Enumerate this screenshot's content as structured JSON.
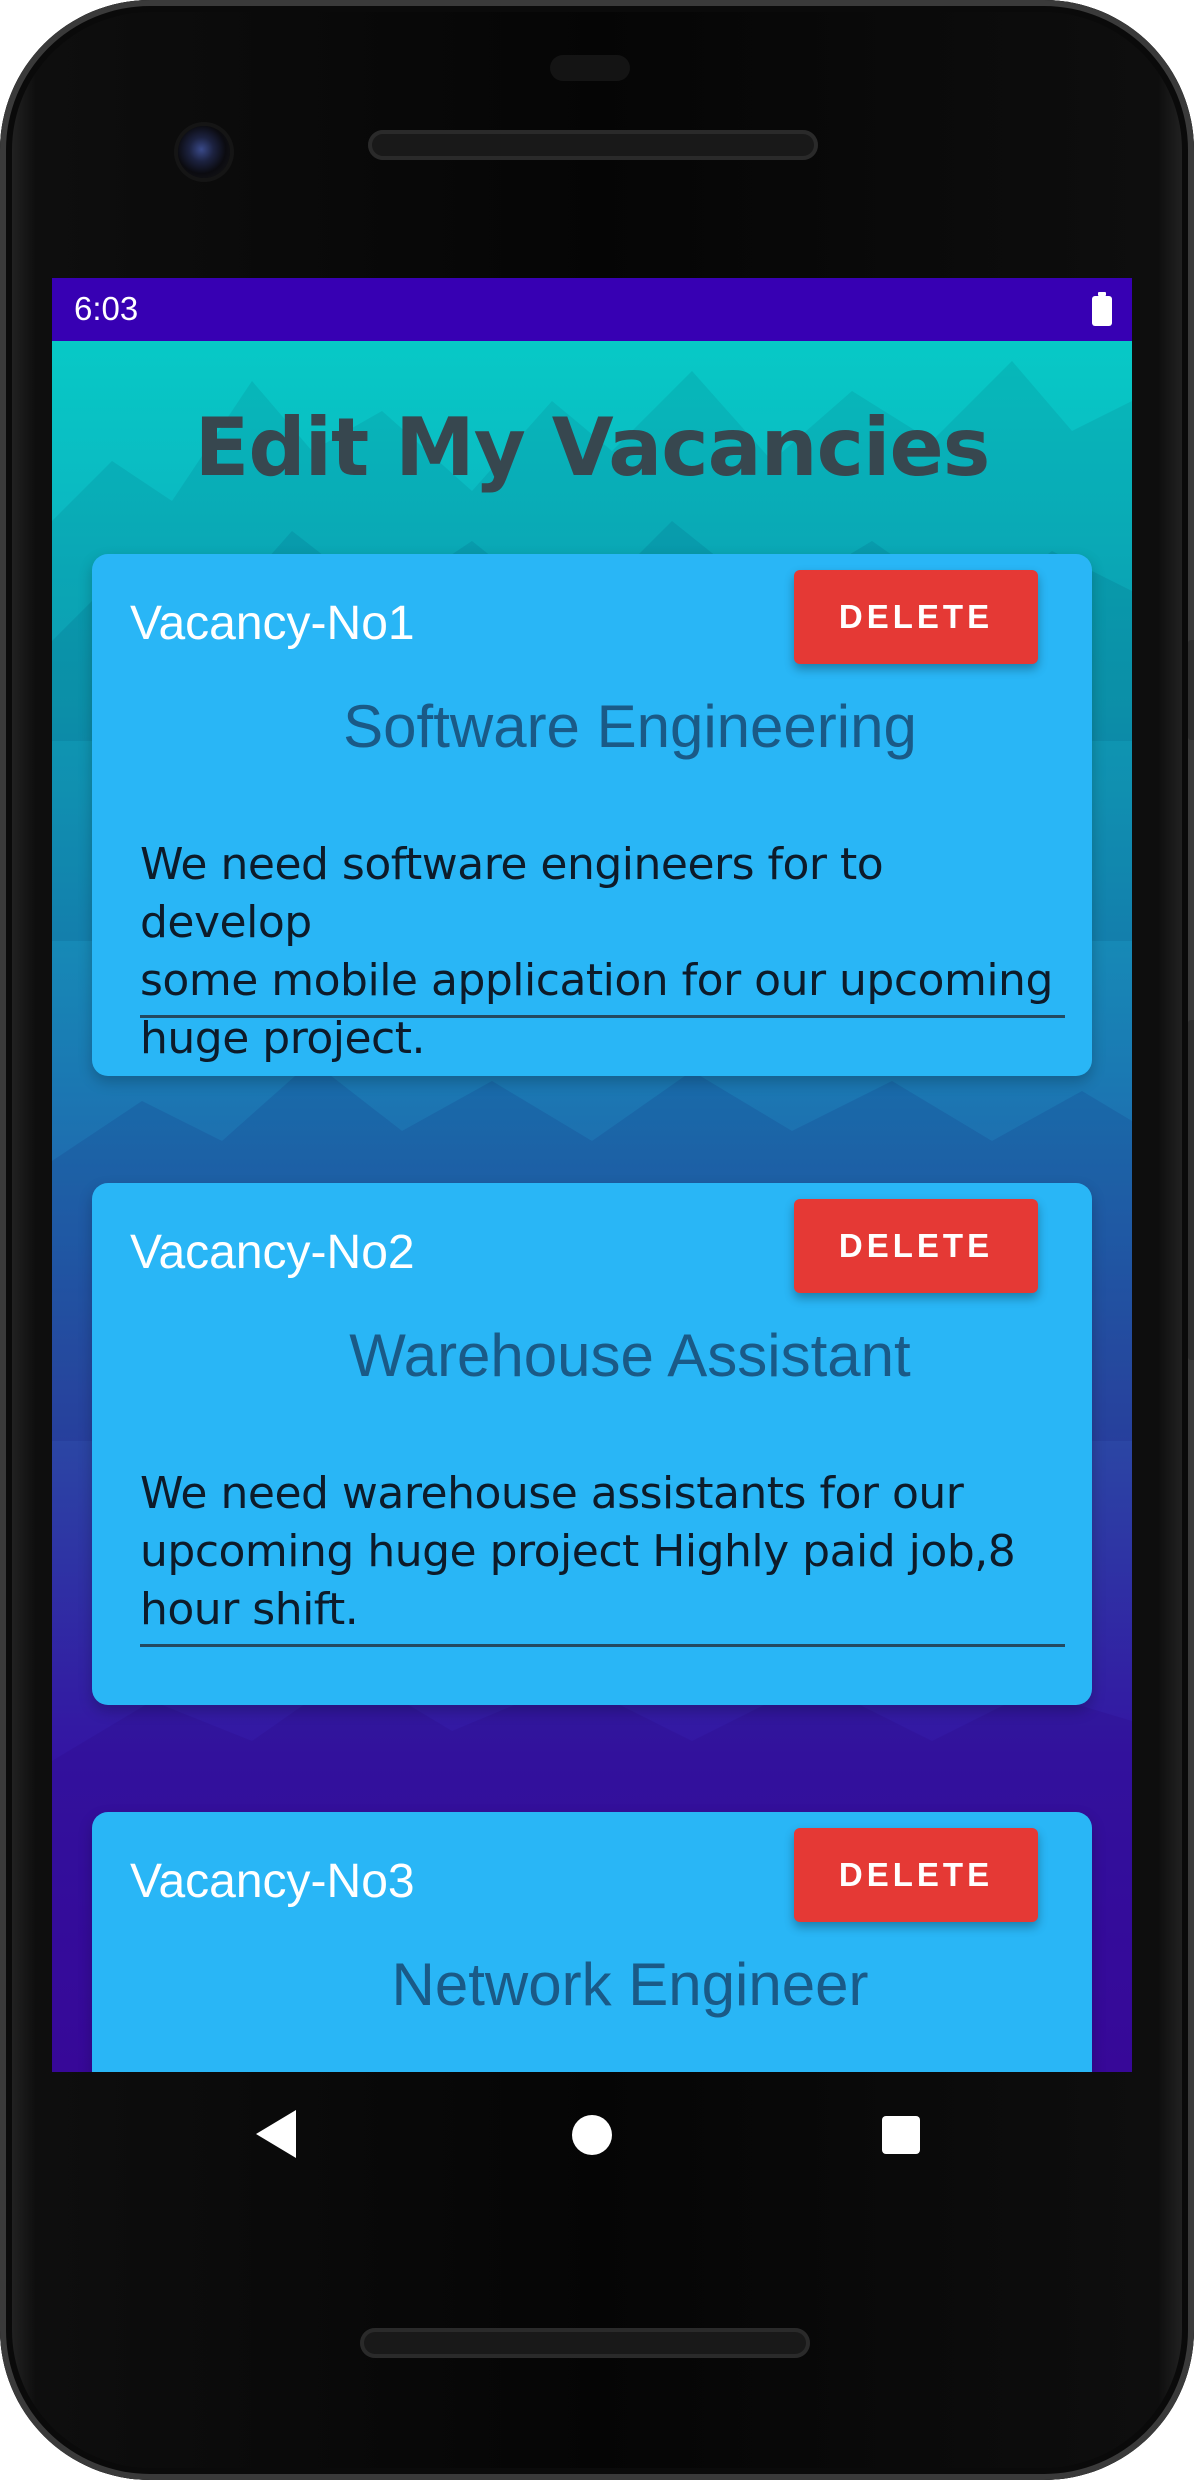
{
  "status_bar": {
    "time": "6:03",
    "icon": "battery-icon"
  },
  "page": {
    "title": "Edit My Vacancies"
  },
  "colors": {
    "status_bar": "#3700b3",
    "card": "#29b6f6",
    "delete_button": "#e53935",
    "title_text": "#37474f"
  },
  "vacancies": [
    {
      "number": "Vacancy-No1",
      "delete_label": "DELETE",
      "title": "Software Engineering",
      "description_lines": [
        "We need software engineers for to develop",
        "some mobile application for our upcoming",
        "huge project."
      ]
    },
    {
      "number": "Vacancy-No2",
      "delete_label": "DELETE",
      "title": "Warehouse Assistant",
      "description_lines": [
        "We need warehouse assistants for our",
        "upcoming huge project Highly paid job,8",
        "hour shift."
      ]
    },
    {
      "number": "Vacancy-No3",
      "delete_label": "DELETE",
      "title": "Network Engineer",
      "description_lines": []
    }
  ],
  "nav_bar": {
    "back_icon": "back-triangle-icon",
    "home_icon": "home-circle-icon",
    "recents_icon": "recents-square-icon"
  }
}
